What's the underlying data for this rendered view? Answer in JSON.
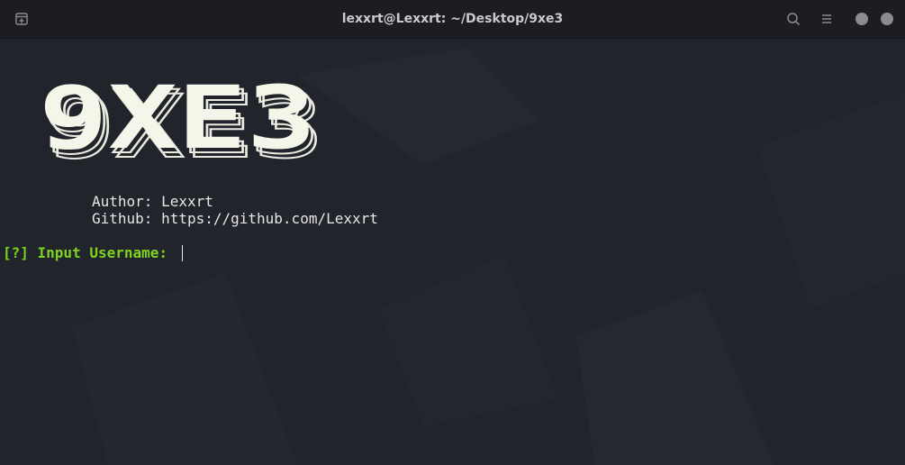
{
  "titlebar": {
    "title": "lexxrt@Lexxrt: ~/Desktop/9xe3",
    "icons": [
      "new-tab-icon",
      "search-icon",
      "hamburger-menu-icon",
      "minimize-icon",
      "close-icon"
    ]
  },
  "terminal": {
    "banner_text": "9XE3",
    "author_line": "Author: Lexxrt",
    "github_line": "Github: https://github.com/Lexxrt",
    "prompt": "[?] Input Username: "
  },
  "colors": {
    "background": "#22242b",
    "titlebar": "#1c1d22",
    "text": "#e6e6e6",
    "prompt": "#7ed321",
    "banner_fill": "#f4f6ea"
  }
}
